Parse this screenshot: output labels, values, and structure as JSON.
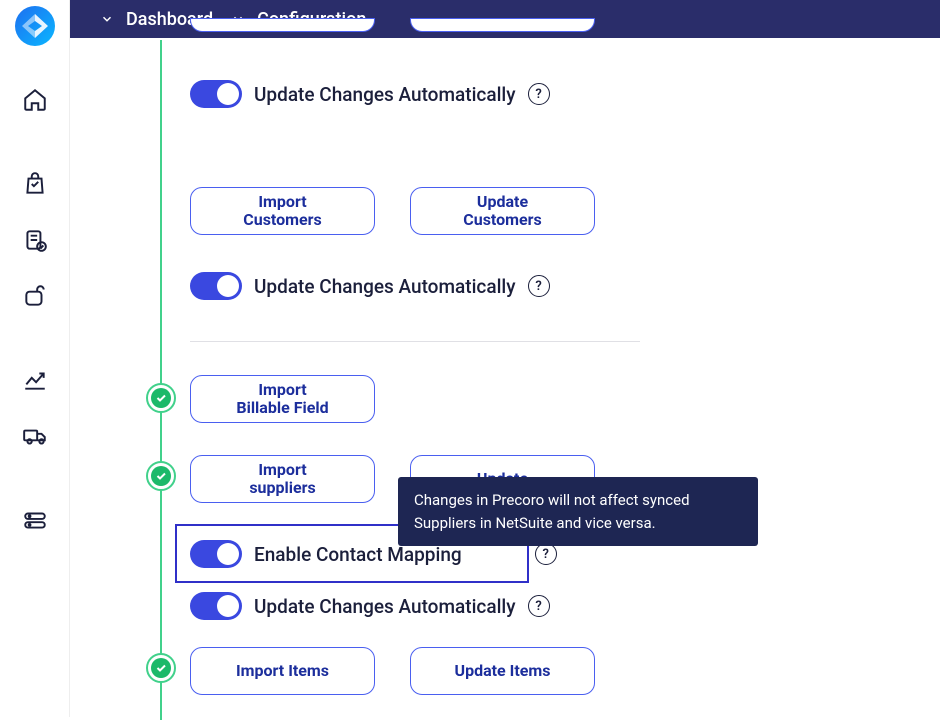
{
  "breadcrumb": {
    "dashboard": "Dashboard",
    "configuration": "Configuration"
  },
  "sections": {
    "toggle_auto_1": "Update Changes Automatically",
    "btn_import_customers": "Import\nCustomers",
    "btn_update_customers": "Update\nCustomers",
    "toggle_auto_2": "Update Changes Automatically",
    "btn_import_billable": "Import\nBillable Field",
    "btn_import_suppliers": "Import\nsuppliers",
    "btn_update_suppliers": "Update",
    "toggle_contact_mapping": "Enable Contact Mapping",
    "toggle_auto_3": "Update Changes Automatically",
    "btn_import_items": "Import Items",
    "btn_update_items": "Update Items"
  },
  "tooltip": {
    "text": "Changes in Precoro will not affect synced Suppliers in NetSuite and vice versa."
  },
  "help_glyph": "?"
}
